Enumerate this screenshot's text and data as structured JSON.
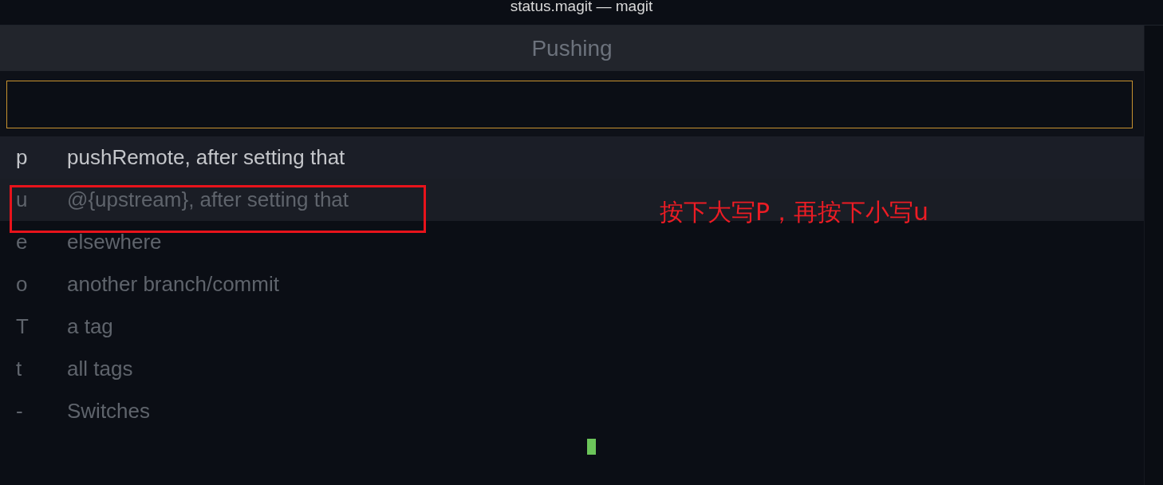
{
  "window": {
    "title": "status.magit — magit"
  },
  "popup": {
    "title": "Pushing",
    "items": [
      {
        "key": "p",
        "label": "pushRemote, after setting that",
        "selected": true,
        "hovered": false
      },
      {
        "key": "u",
        "label": "@{upstream}, after setting that",
        "selected": false,
        "hovered": true
      },
      {
        "key": "e",
        "label": "elsewhere",
        "selected": false,
        "hovered": false
      },
      {
        "key": "o",
        "label": "another branch/commit",
        "selected": false,
        "hovered": false
      },
      {
        "key": "T",
        "label": "a tag",
        "selected": false,
        "hovered": false
      },
      {
        "key": "t",
        "label": "all tags",
        "selected": false,
        "hovered": false
      },
      {
        "key": "-",
        "label": "Switches",
        "selected": false,
        "hovered": false
      }
    ]
  },
  "annotation": {
    "text": "按下大写P，再按下小写u"
  }
}
